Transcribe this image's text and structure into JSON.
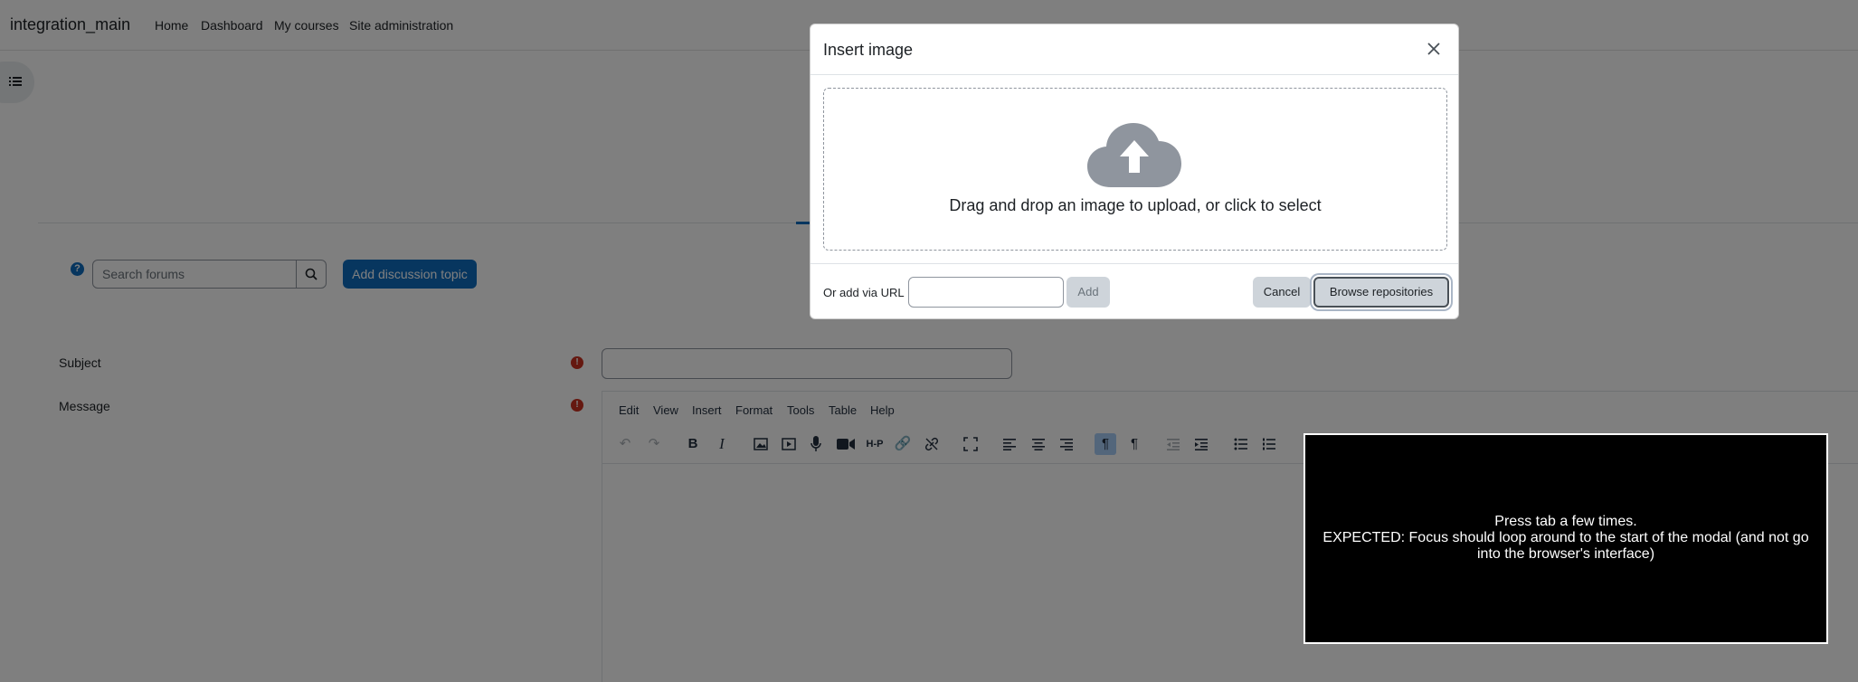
{
  "navbar": {
    "brand": "integration_main",
    "items": [
      {
        "label": "Home"
      },
      {
        "label": "Dashboard"
      },
      {
        "label": "My courses"
      },
      {
        "label": "Site administration"
      }
    ]
  },
  "forum": {
    "help_symbol": "?",
    "search_placeholder": "Search forums",
    "add_topic_label": "Add discussion topic"
  },
  "form": {
    "subject_label": "Subject",
    "message_label": "Message",
    "required_symbol": "!"
  },
  "editor": {
    "menu": [
      "Edit",
      "View",
      "Insert",
      "Format",
      "Tools",
      "Table",
      "Help"
    ],
    "toolbar_icons": [
      "undo-icon",
      "redo-icon",
      "bold-icon",
      "italic-icon",
      "image-icon",
      "media-icon",
      "microphone-icon",
      "video-icon",
      "h5p-icon",
      "link-icon",
      "unlink-icon",
      "fullscreen-icon",
      "align-left-icon",
      "align-center-icon",
      "align-right-icon",
      "ltr-icon",
      "rtl-icon",
      "outdent-icon",
      "indent-icon",
      "bullet-list-icon",
      "numbered-list-icon"
    ],
    "bold_glyph": "B",
    "italic_glyph": "I",
    "h5p_glyph": "H-P"
  },
  "modal": {
    "title": "Insert image",
    "dropzone_text": "Drag and drop an image to upload, or click to select",
    "url_label": "Or add via URL",
    "url_value": "",
    "add_label": "Add",
    "cancel_label": "Cancel",
    "browse_label": "Browse repositories"
  },
  "instructions": {
    "line1": "Press tab a few times.",
    "line2": "EXPECTED: Focus should loop around to the start of the modal (and not go into the browser's interface)"
  },
  "colors": {
    "primary": "#0f6cbf",
    "required": "#ca3120",
    "backdrop": "rgba(0,0,0,0.5)",
    "cloud": "#8f959e"
  }
}
